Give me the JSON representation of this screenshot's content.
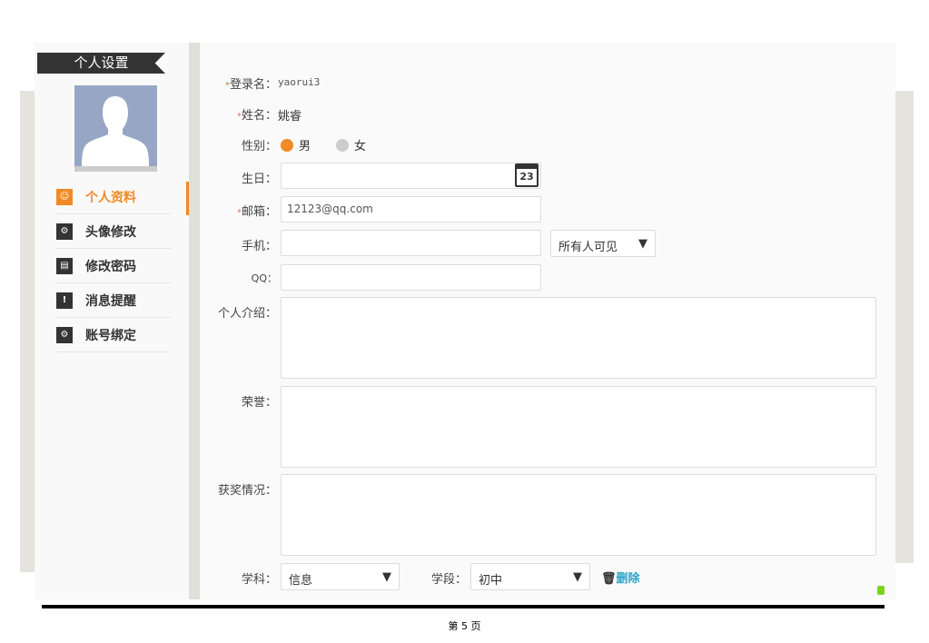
{
  "sidebar": {
    "title": "个人设置",
    "items": [
      {
        "label": "个人资料",
        "icon": "profile-icon",
        "active": true
      },
      {
        "label": "头像修改",
        "icon": "avatar-edit-icon"
      },
      {
        "label": "修改密码",
        "icon": "password-icon"
      },
      {
        "label": "消息提醒",
        "icon": "message-alert-icon"
      },
      {
        "label": "账号绑定",
        "icon": "account-bind-icon"
      }
    ]
  },
  "form": {
    "login_label": "登录名：",
    "login_value": "yaorui3",
    "name_label": "姓名：",
    "name_value": "姚睿",
    "gender_label": "性别：",
    "gender_male": "男",
    "gender_female": "女",
    "birthday_label": "生日：",
    "birthday_value": "",
    "calendar_day": "23",
    "email_label": "邮箱：",
    "email_value": "12123@qq.com",
    "phone_label": "手机：",
    "phone_value": "",
    "phone_visibility": "所有人可见",
    "qq_label": "QQ：",
    "qq_value": "",
    "intro_label": "个人介绍：",
    "honor_label": "荣誉：",
    "awards_label": "获奖情况：",
    "subject_label": "学科：",
    "subject_value": "信息",
    "stage_label": "学段：",
    "stage_value": "初中",
    "delete_label": "删除",
    "required_mark": "*"
  },
  "footer": {
    "page": "第 5 页"
  },
  "colors": {
    "accent": "#f08a24",
    "link": "#2aa3c9",
    "required": "#f26b5b"
  }
}
